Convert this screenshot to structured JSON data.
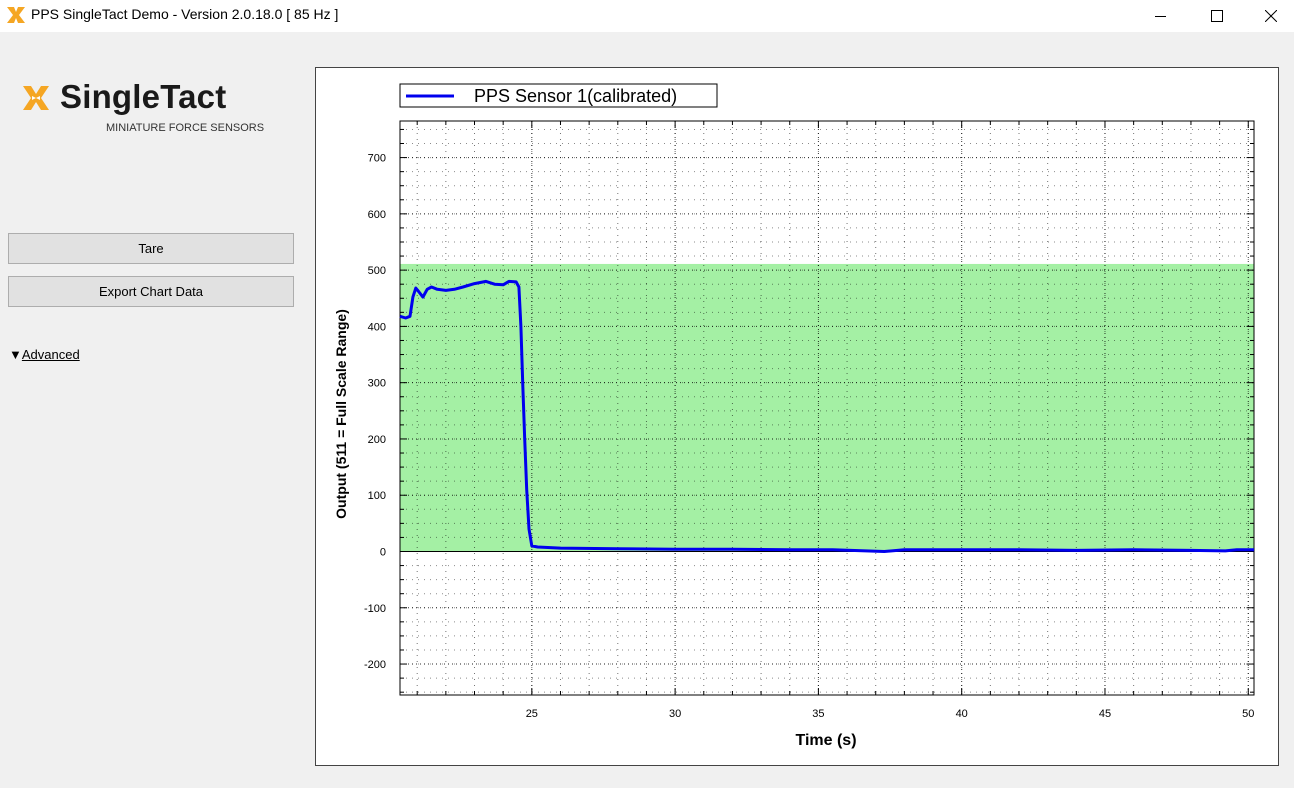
{
  "window": {
    "title": "PPS SingleTact Demo - Version 2.0.18.0 [ 85 Hz ]",
    "app_icon": "singletact-x-icon",
    "controls": {
      "minimize": "minimize-icon",
      "maximize": "maximize-icon",
      "close": "close-icon"
    }
  },
  "logo": {
    "name": "SingleTact",
    "subtitle": "MINIATURE FORCE SENSORS"
  },
  "sidebar": {
    "tare_label": "Tare",
    "export_label": "Export Chart Data",
    "advanced_arrow": "▼",
    "advanced_label": "Advanced"
  },
  "colors": {
    "line": "#0000ee",
    "band": "#a4f0a4",
    "logo_orange": "#f5a623"
  },
  "chart_data": {
    "type": "line",
    "xlabel": "Time (s)",
    "ylabel": "Output (511 = Full Scale Range)",
    "xlim": [
      20.4,
      50.2
    ],
    "ylim": [
      -255,
      765
    ],
    "xticks": [
      25,
      30,
      35,
      40,
      45,
      50
    ],
    "yticks": [
      -200,
      -100,
      0,
      100,
      200,
      300,
      400,
      500,
      600,
      700
    ],
    "grid": true,
    "legend_position": "top-left",
    "band": {
      "from": 0,
      "to": 511,
      "color": "#a4f0a4"
    },
    "series": [
      {
        "name": "PPS Sensor 1(calibrated)",
        "color": "#0000ee",
        "x": [
          20.4,
          20.6,
          20.75,
          20.85,
          20.95,
          21.05,
          21.2,
          21.35,
          21.5,
          21.7,
          22.0,
          22.3,
          22.6,
          23.0,
          23.4,
          23.7,
          24.0,
          24.2,
          24.45,
          24.55,
          24.62,
          24.68,
          24.75,
          24.82,
          24.9,
          25.0,
          25.2,
          26.0,
          28.0,
          30.0,
          32.0,
          34.0,
          35.5,
          37.3,
          38.0,
          40.0,
          42.0,
          44.0,
          46.0,
          48.0,
          49.2,
          49.6,
          50.2
        ],
        "y": [
          418,
          415,
          418,
          452,
          468,
          462,
          452,
          466,
          470,
          466,
          464,
          466,
          470,
          476,
          480,
          475,
          474,
          480,
          479,
          470,
          400,
          300,
          200,
          110,
          40,
          10,
          8,
          6,
          5,
          4,
          4,
          3,
          3,
          0,
          3,
          3,
          3,
          2,
          3,
          2,
          1,
          3,
          3
        ]
      }
    ]
  }
}
